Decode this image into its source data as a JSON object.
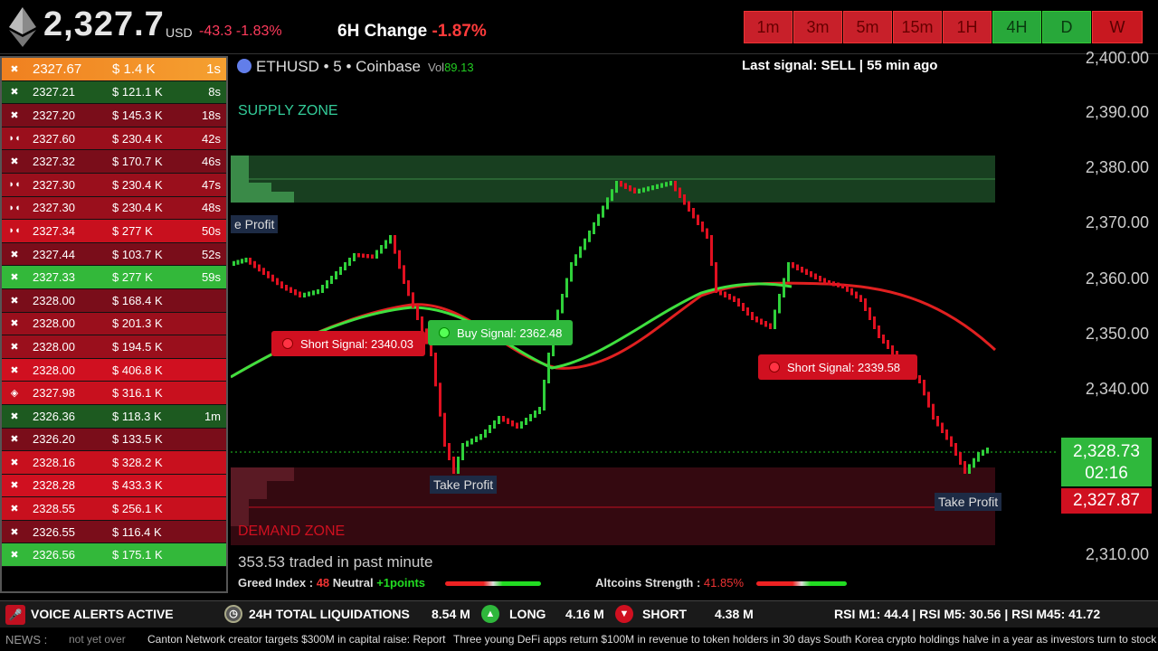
{
  "header": {
    "price": "2,327.7",
    "currency": "USD",
    "change": "-43.3 -1.83%",
    "six_h_label": "6H Change",
    "six_h_value": "-1.87%"
  },
  "timeframes": [
    "1m",
    "3m",
    "5m",
    "15m",
    "1H",
    "4H",
    "D",
    "W"
  ],
  "trades": [
    {
      "price": "2327.67",
      "value": "$ 1.4 K",
      "time": "1s",
      "style": "o1"
    },
    {
      "price": "2327.21",
      "value": "$ 121.1 K",
      "time": "8s",
      "style": "g1"
    },
    {
      "price": "2327.20",
      "value": "$ 145.3 K",
      "time": "18s",
      "style": "r1"
    },
    {
      "price": "2327.60",
      "value": "$ 230.4 K",
      "time": "42s",
      "style": "r2"
    },
    {
      "price": "2327.32",
      "value": "$ 170.7 K",
      "time": "46s",
      "style": "r1"
    },
    {
      "price": "2327.30",
      "value": "$ 230.4 K",
      "time": "47s",
      "style": "r2"
    },
    {
      "price": "2327.30",
      "value": "$ 230.4 K",
      "time": "48s",
      "style": "r2"
    },
    {
      "price": "2327.34",
      "value": "$ 277 K",
      "time": "50s",
      "style": "r3"
    },
    {
      "price": "2327.44",
      "value": "$ 103.7 K",
      "time": "52s",
      "style": "r1"
    },
    {
      "price": "2327.33",
      "value": "$ 277 K",
      "time": "59s",
      "style": "g2"
    },
    {
      "price": "2328.00",
      "value": "$ 168.4 K",
      "time": "",
      "style": "r1"
    },
    {
      "price": "2328.00",
      "value": "$ 201.3 K",
      "time": "",
      "style": "r2"
    },
    {
      "price": "2328.00",
      "value": "$ 194.5 K",
      "time": "",
      "style": "r2"
    },
    {
      "price": "2328.00",
      "value": "$ 406.8 K",
      "time": "",
      "style": "r4"
    },
    {
      "price": "2327.98",
      "value": "$ 316.1 K",
      "time": "",
      "style": "r3"
    },
    {
      "price": "2326.36",
      "value": "$ 118.3 K",
      "time": "1m",
      "style": "g1"
    },
    {
      "price": "2326.20",
      "value": "$ 133.5 K",
      "time": "",
      "style": "r1"
    },
    {
      "price": "2328.16",
      "value": "$ 328.2 K",
      "time": "",
      "style": "r3"
    },
    {
      "price": "2328.28",
      "value": "$ 433.3 K",
      "time": "",
      "style": "r4"
    },
    {
      "price": "2328.55",
      "value": "$ 256.1 K",
      "time": "",
      "style": "r3"
    },
    {
      "price": "2326.55",
      "value": "$ 116.4 K",
      "time": "",
      "style": "r1"
    },
    {
      "price": "2326.56",
      "value": "$ 175.1 K",
      "time": "",
      "style": "g2"
    }
  ],
  "chart": {
    "symbol": "ETHUSD • 5 • Coinbase",
    "vol_label": "Vol",
    "vol_value": "89.13",
    "last_signal": "Last signal: SELL  | 55 min ago",
    "supply_zone": "SUPPLY ZONE",
    "demand_zone": "DEMAND ZONE",
    "short1": "Short Signal: 2340.03",
    "buy1": "Buy Signal: 2362.48",
    "short2": "Short Signal: 2339.58",
    "tp_top": "e Profit",
    "tp1": "Take Profit",
    "tp2": "Take Profit"
  },
  "axis": [
    "2,400.00",
    "2,390.00",
    "2,380.00",
    "2,370.00",
    "2,360.00",
    "2,350.00",
    "2,340.00",
    "2,310.00"
  ],
  "price_box": {
    "current": "2,328.73",
    "countdown": "02:16",
    "bid": "2,327.87"
  },
  "stats": {
    "traded": "353.53  traded in past minute",
    "greed_label": "Greed Index :",
    "greed_value": "48",
    "greed_text": "Neutral",
    "greed_points": "+1points",
    "alt_label": "Altcoins Strength :",
    "alt_value": "41.85%"
  },
  "bottom": {
    "voice": "VOICE ALERTS ACTIVE",
    "liq_label": "24H TOTAL  LIQUIDATIONS",
    "liq_value": "8.54 M",
    "long_label": "LONG",
    "long_value": "4.16 M",
    "short_label": "SHORT",
    "short_value": "4.38 M",
    "rsi": "RSI M1: 44.4 | RSI M5: 30.56 | RSI M45: 41.72"
  },
  "news": {
    "label": "NEWS :",
    "items": [
      "not yet over",
      "Canton Network creator targets $300M in capital raise: Report",
      "Three young DeFi apps return $100M in revenue to token holders in 30 days",
      "South Korea crypto holdings halve in a year as investors turn to stock ma"
    ]
  }
}
